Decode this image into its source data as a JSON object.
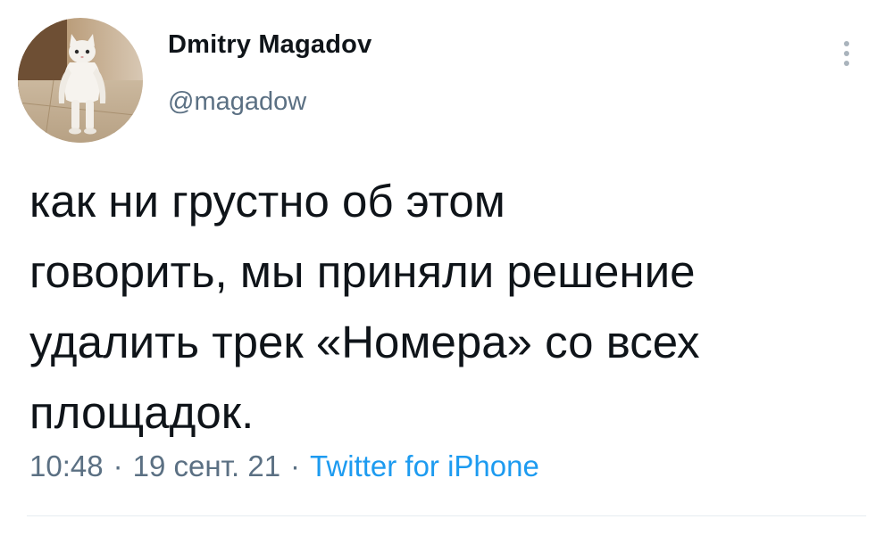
{
  "author": {
    "display_name": "Dmitry Magadov",
    "handle": "@magadow"
  },
  "tweet": {
    "lines": [
      "как ни грустно об этом",
      "говорить, мы приняли решение",
      "удалить трек «Номера» со всех",
      "площадок."
    ]
  },
  "meta": {
    "time": "10:48",
    "date": "19 сент. 21",
    "separator": "·",
    "source": "Twitter for iPhone"
  },
  "colors": {
    "text": "#0f1419",
    "secondary": "#5b7083",
    "link": "#1d9bf0",
    "divider": "#e6ecf0"
  },
  "icons": {
    "more": "vertical-ellipsis-icon",
    "avatar": "white-cat-photo"
  }
}
